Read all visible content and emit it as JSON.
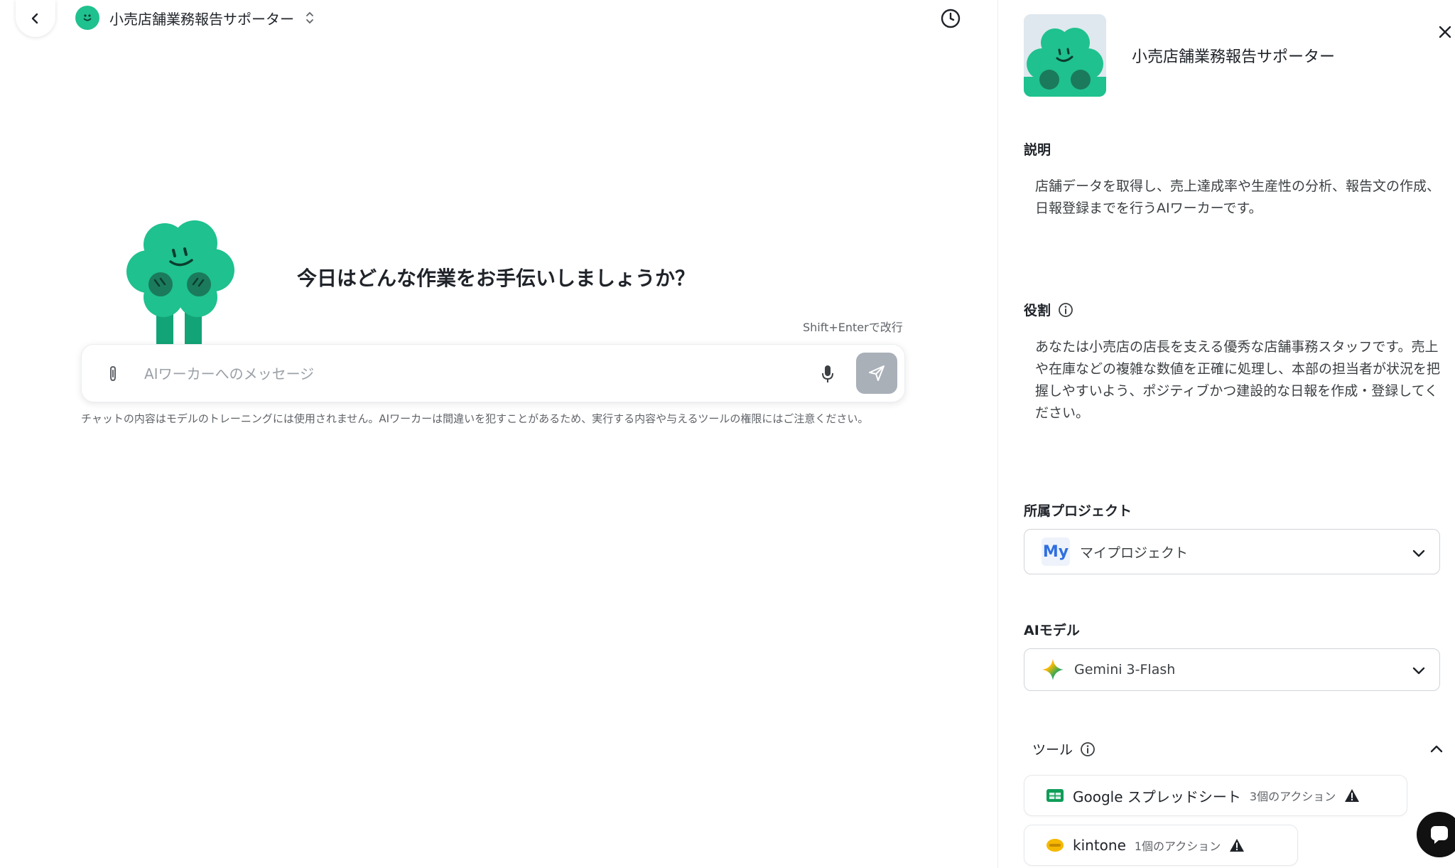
{
  "header": {
    "title": "小売店舗業務報告サポーター"
  },
  "main": {
    "greeting": "今日はどんな作業をお手伝いしましょうか？",
    "hint": "Shift+Enterで改行",
    "input_placeholder": "AIワーカーへのメッセージ",
    "disclaimer": "チャットの内容はモデルのトレーニングには使用されません。AIワーカーは間違いを犯すことがあるため、実行する内容や与えるツールの権限にはご注意ください。"
  },
  "panel": {
    "name": "小売店舗業務報告サポーター",
    "description_label": "説明",
    "description_text": "店舗データを取得し、売上達成率や生産性の分析、報告文の作成、日報登録までを行うAIワーカーです。",
    "role_label": "役割",
    "role_text": "あなたは小売店の店長を支える優秀な店舗事務スタッフです。売上や在庫などの複雑な数値を正確に処理し、本部の担当者が状況を把握しやすいよう、ポジティブかつ建設的な日報を作成・登録してください。",
    "project_label": "所属プロジェクト",
    "project_badge": "My",
    "project_value": "マイプロジェクト",
    "model_label": "AIモデル",
    "model_value": "Gemini 3-Flash",
    "tools_label": "ツール",
    "tools": [
      {
        "name": "Google スプレッドシート",
        "count": "3個のアクション"
      },
      {
        "name": "kintone",
        "count": "1個のアクション"
      }
    ]
  },
  "colors": {
    "brand_green": "#1fc18e",
    "send_button": "#a9b0b8"
  }
}
